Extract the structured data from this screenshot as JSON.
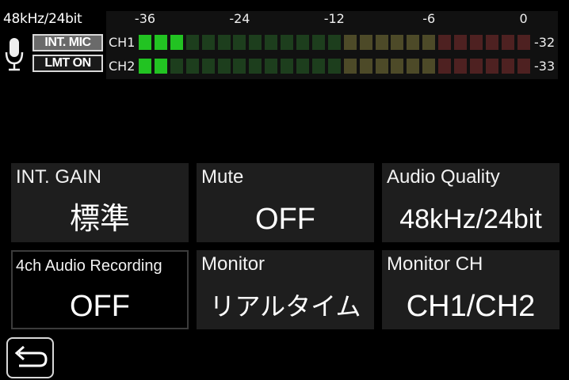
{
  "header": {
    "audio_format": "48kHz/24bit",
    "mic_tag": "INT. MIC",
    "limiter_tag": "LMT ON",
    "mic_icon": "microphone-icon"
  },
  "level_meter": {
    "scale_labels": [
      "-36",
      "-24",
      "-12",
      "-6",
      "0"
    ],
    "channels": [
      {
        "label": "CH1",
        "lit_segments": 3,
        "peak": "-32"
      },
      {
        "label": "CH2",
        "lit_segments": 2,
        "peak": "-33"
      }
    ],
    "segment_count": 25,
    "colors": {
      "green_lit": "#22c322",
      "green_dim": "#1d3e1d",
      "yellow_dim": "#4d4a28",
      "red_dim": "#4e2121"
    }
  },
  "tiles": [
    {
      "label": "INT. GAIN",
      "value": "標準"
    },
    {
      "label": "Mute",
      "value": "OFF"
    },
    {
      "label": "Audio Quality",
      "value": "48kHz/24bit"
    },
    {
      "label": "4ch Audio Recording",
      "value": "OFF"
    },
    {
      "label": "Monitor",
      "value": "リアルタイム"
    },
    {
      "label": "Monitor CH",
      "value": "CH1/CH2"
    }
  ],
  "back_icon": "return-arrow-icon"
}
